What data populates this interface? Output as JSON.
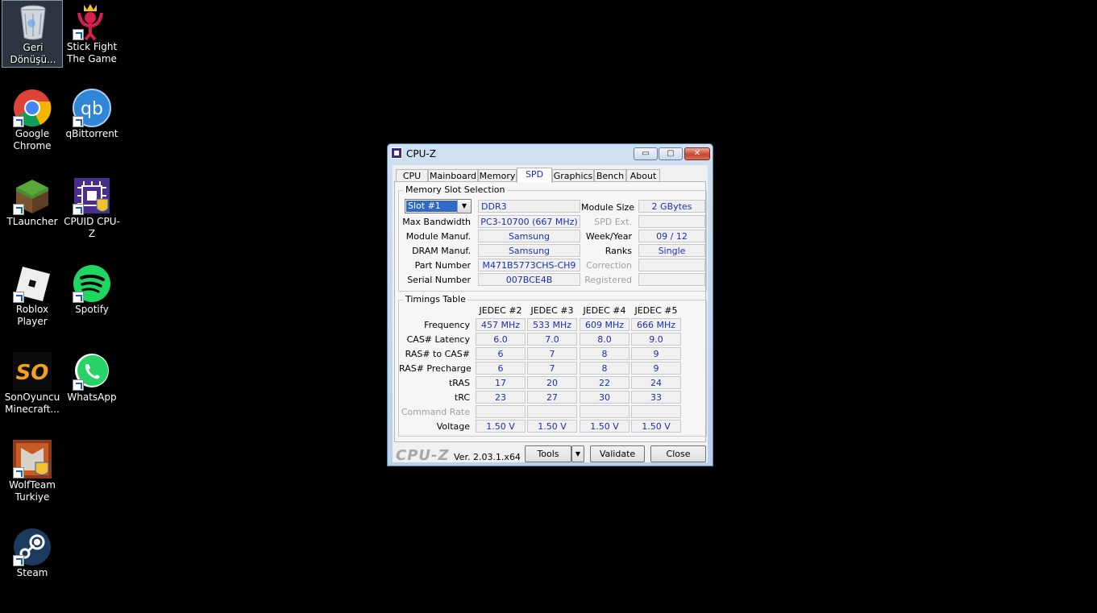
{
  "desktop": {
    "icons": [
      {
        "label": "Geri Dönüşü...",
        "icon": "recycle-bin-icon"
      },
      {
        "label": "Stick Fight The Game",
        "icon": "stick-fight-icon"
      },
      {
        "label": "Google Chrome",
        "icon": "chrome-icon"
      },
      {
        "label": "qBittorrent",
        "icon": "qbittorrent-icon"
      },
      {
        "label": "TLauncher",
        "icon": "tlauncher-icon"
      },
      {
        "label": "CPUID CPU-Z",
        "icon": "cpuz-icon"
      },
      {
        "label": "Roblox Player",
        "icon": "roblox-icon"
      },
      {
        "label": "Spotify",
        "icon": "spotify-icon"
      },
      {
        "label": "SonOyuncu Minecraft...",
        "icon": "sonoyuncu-icon"
      },
      {
        "label": "WhatsApp",
        "icon": "whatsapp-icon"
      },
      {
        "label": "WolfTeam Turkiye",
        "icon": "wolfteam-icon"
      },
      {
        "label": "Steam",
        "icon": "steam-icon"
      }
    ],
    "qb_text": "qb",
    "sonoyuncu_text": "SO"
  },
  "window": {
    "title": "CPU-Z",
    "controls": {
      "minimize": "▭",
      "maximize": "▢",
      "close": "✕"
    },
    "tabs": [
      "CPU",
      "Mainboard",
      "Memory",
      "SPD",
      "Graphics",
      "Bench",
      "About"
    ],
    "active_tab": "SPD",
    "slot_group_title": "Memory Slot Selection",
    "slot_selected": "Slot #1",
    "slot_dropdown_arrow": "▼",
    "memory_type": "DDR3",
    "labels": {
      "max_bandwidth": "Max Bandwidth",
      "module_manuf": "Module Manuf.",
      "dram_manuf": "DRAM Manuf.",
      "part_number": "Part Number",
      "serial_number": "Serial Number",
      "module_size": "Module Size",
      "spd_ext": "SPD Ext.",
      "week_year": "Week/Year",
      "ranks": "Ranks",
      "correction": "Correction",
      "registered": "Registered"
    },
    "values": {
      "max_bandwidth": "PC3-10700 (667 MHz)",
      "module_manuf": "Samsung",
      "dram_manuf": "Samsung",
      "part_number": "M471B5773CHS-CH9",
      "serial_number": "007BCE4B",
      "module_size": "2 GBytes",
      "spd_ext": "",
      "week_year": "09 / 12",
      "ranks": "Single",
      "correction": "",
      "registered": ""
    },
    "timings_group_title": "Timings Table",
    "timing_columns": [
      "JEDEC #2",
      "JEDEC #3",
      "JEDEC #4",
      "JEDEC #5"
    ],
    "timing_rows": [
      {
        "label": "Frequency",
        "values": [
          "457 MHz",
          "533 MHz",
          "609 MHz",
          "666 MHz"
        ]
      },
      {
        "label": "CAS# Latency",
        "values": [
          "6.0",
          "7.0",
          "8.0",
          "9.0"
        ]
      },
      {
        "label": "RAS# to CAS#",
        "values": [
          "6",
          "7",
          "8",
          "9"
        ]
      },
      {
        "label": "RAS# Precharge",
        "values": [
          "6",
          "7",
          "8",
          "9"
        ]
      },
      {
        "label": "tRAS",
        "values": [
          "17",
          "20",
          "22",
          "24"
        ]
      },
      {
        "label": "tRC",
        "values": [
          "23",
          "27",
          "30",
          "33"
        ]
      },
      {
        "label": "Command Rate",
        "values": [
          "",
          "",
          "",
          ""
        ]
      },
      {
        "label": "Voltage",
        "values": [
          "1.50 V",
          "1.50 V",
          "1.50 V",
          "1.50 V"
        ]
      }
    ],
    "footer": {
      "brand": "CPU-Z",
      "version": "Ver. 2.03.1.x64",
      "tools_label": "Tools",
      "tools_arrow": "▼",
      "validate_label": "Validate",
      "close_label": "Close"
    }
  }
}
